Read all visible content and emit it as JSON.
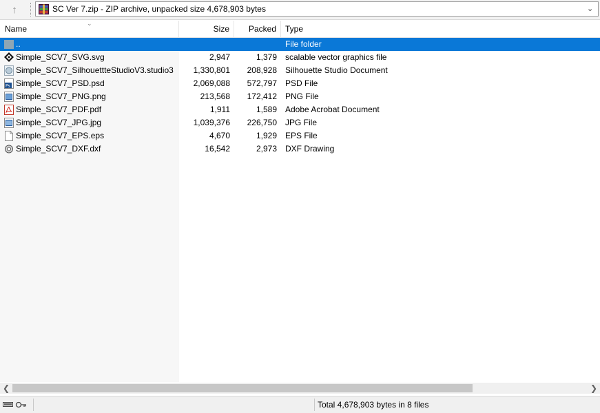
{
  "address": {
    "up_icon": "up-arrow-icon",
    "archive_icon": "winrar-archive-icon",
    "path": "SC Ver 7.zip - ZIP archive, unpacked size 4,678,903 bytes",
    "dropdown_icon": "chevron-down-icon"
  },
  "columns": {
    "name": "Name",
    "size": "Size",
    "packed": "Packed",
    "type": "Type"
  },
  "files": [
    {
      "name": "..",
      "size": "",
      "packed": "",
      "type": "File folder",
      "icon": "parent-folder-icon"
    },
    {
      "name": "Simple_SCV7_SVG.svg",
      "size": "2,947",
      "packed": "1,379",
      "type": "scalable vector graphics file",
      "icon": "svg-file-icon"
    },
    {
      "name": "Simple_SCV7_SilhouettteStudioV3.studio3",
      "size": "1,330,801",
      "packed": "208,928",
      "type": "Silhouette Studio Document",
      "icon": "silhouette-studio-file-icon"
    },
    {
      "name": "Simple_SCV7_PSD.psd",
      "size": "2,069,088",
      "packed": "572,797",
      "type": "PSD File",
      "icon": "psd-file-icon"
    },
    {
      "name": "Simple_SCV7_PNG.png",
      "size": "213,568",
      "packed": "172,412",
      "type": "PNG File",
      "icon": "png-file-icon"
    },
    {
      "name": "Simple_SCV7_PDF.pdf",
      "size": "1,911",
      "packed": "1,589",
      "type": "Adobe Acrobat Document",
      "icon": "pdf-file-icon"
    },
    {
      "name": "Simple_SCV7_JPG.jpg",
      "size": "1,039,376",
      "packed": "226,750",
      "type": "JPG File",
      "icon": "jpg-file-icon"
    },
    {
      "name": "Simple_SCV7_EPS.eps",
      "size": "4,670",
      "packed": "1,929",
      "type": "EPS File",
      "icon": "eps-file-icon"
    },
    {
      "name": "Simple_SCV7_DXF.dxf",
      "size": "16,542",
      "packed": "2,973",
      "type": "DXF Drawing",
      "icon": "dxf-file-icon"
    }
  ],
  "selected_row": 0,
  "status": {
    "text": "Total 4,678,903 bytes in 8 files"
  },
  "colors": {
    "selection": "#0a78d7",
    "name_column_bg": "#f7f7f7"
  }
}
